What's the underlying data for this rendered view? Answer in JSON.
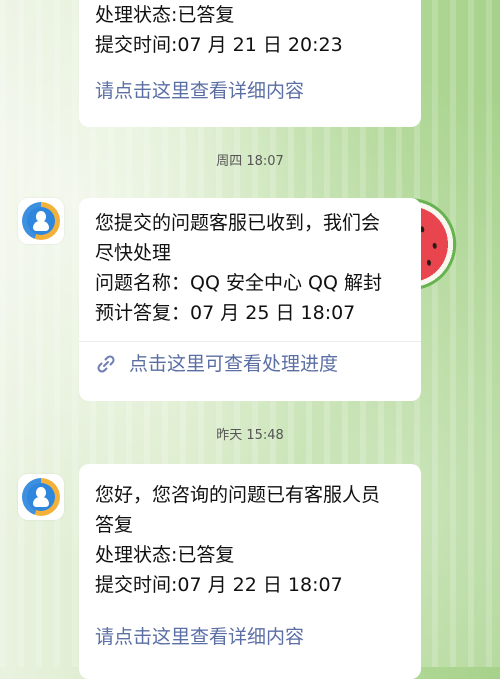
{
  "messages": [
    {
      "lines": [
        "处理状态:已答复",
        "提交时间:07 月 21 日 20:23"
      ],
      "link": "请点击这里查看详细内容"
    },
    {
      "timestamp": "周四 18:07",
      "lines": [
        "您提交的问题客服已收到，我们会",
        "尽快处理",
        "问题名称：QQ 安全中心 QQ 解封",
        "预计答复：07 月 25 日 18:07"
      ],
      "link": "点击这里可查看处理进度",
      "link_icon": "link-icon"
    },
    {
      "timestamp": "昨天 15:48",
      "lines": [
        "您好，您咨询的问题已有客服人员",
        "答复",
        "处理状态:已答复",
        "提交时间:07 月 22 日 18:07"
      ],
      "link": "请点击这里查看详细内容"
    }
  ],
  "avatar_icon": "qq-security-center-avatar-icon",
  "colors": {
    "bubble": "#ffffff",
    "link": "#5b6fa5",
    "text": "#111111",
    "timestamp": "#555555"
  }
}
